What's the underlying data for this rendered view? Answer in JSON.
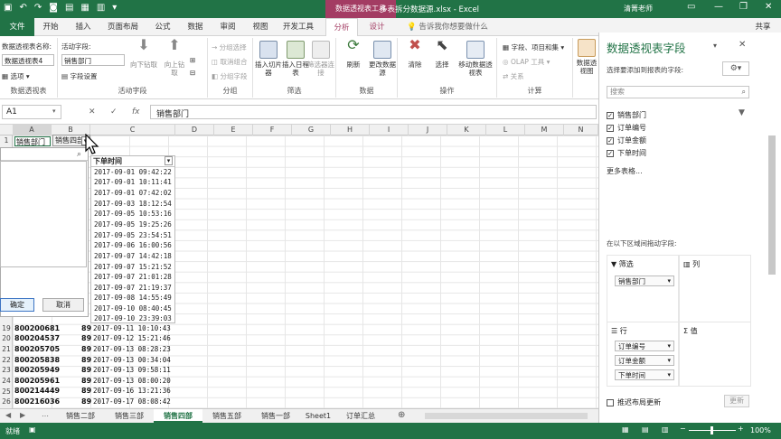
{
  "window": {
    "title": "多表拆分数据源.xlsx - Excel",
    "context_tab_title": "数据透视表工具",
    "user": "清箐老师"
  },
  "tabs": [
    {
      "label": "文件"
    },
    {
      "label": "开始"
    },
    {
      "label": "插入"
    },
    {
      "label": "页面布局"
    },
    {
      "label": "公式"
    },
    {
      "label": "数据"
    },
    {
      "label": "审阅"
    },
    {
      "label": "视图"
    },
    {
      "label": "开发工具"
    },
    {
      "label": "分析"
    },
    {
      "label": "设计"
    },
    {
      "label": "告诉我你想要做什么"
    },
    {
      "label": "共享"
    }
  ],
  "ribbon": {
    "pivot_name_label": "数据透视表名称:",
    "pivot_name_value": "数据透视表4",
    "options_label": "选项",
    "group_pivot": "数据透视表",
    "active_field_label": "活动字段:",
    "active_field_value": "销售部门",
    "field_settings": "字段设置",
    "drill_down": "向下钻取",
    "drill_up": "向上钻",
    "drill_up2": "取",
    "group_active_field": "活动字段",
    "group_selection": "分组选择",
    "ungroup": "取消组合",
    "group_field": "分组字段",
    "group_group": "分组",
    "insert_slicer": "插入切片器",
    "insert_timeline": "插入日程表",
    "filter_connections": "筛选器连接",
    "group_filter": "筛选",
    "refresh": "刷新",
    "change_source": "更改数据源",
    "group_data": "数据",
    "clear": "清除",
    "select": "选择",
    "move_pivot": "移动数据透视表",
    "group_actions": "操作",
    "fields_items": "字段、项目和集",
    "olap_tools": "OLAP 工具",
    "relationships": "关系",
    "group_calc": "计算",
    "pivot_chart": "数据透视图"
  },
  "formula": {
    "namebox": "A1",
    "fx": "fx",
    "content": "销售部门"
  },
  "columns": [
    "A",
    "B",
    "C",
    "D",
    "E",
    "F",
    "G",
    "H",
    "I",
    "J",
    "K",
    "L",
    "M",
    "N"
  ],
  "row1": {
    "a1": "销售部门",
    "b1": "销售四部"
  },
  "filter": {
    "ok": "确定",
    "cancel": "取消",
    "header": "下单时间"
  },
  "dropdown_items": [
    "2017-09-01 09:42:22",
    "2017-09-01 10:11:41",
    "2017-09-01 07:42:02",
    "2017-09-03 18:12:54",
    "2017-09-05 10:53:16",
    "2017-09-05 19:25:26",
    "2017-09-05 23:54:51",
    "2017-09-06 16:00:56",
    "2017-09-07 14:42:18",
    "2017-09-07 15:21:52",
    "2017-09-07 21:01:28",
    "2017-09-07 21:19:37",
    "2017-09-08 14:55:49",
    "2017-09-10 08:40:45",
    "2017-09-10 23:39:03"
  ],
  "rows": [
    {
      "n": "19",
      "a": "800200681",
      "b": "89",
      "c": "2017-09-11 10:10:43"
    },
    {
      "n": "20",
      "a": "800204537",
      "b": "89",
      "c": "2017-09-12 15:21:46"
    },
    {
      "n": "21",
      "a": "800205705",
      "b": "89",
      "c": "2017-09-13 08:28:23"
    },
    {
      "n": "22",
      "a": "800205838",
      "b": "89",
      "c": "2017-09-13 00:34:04"
    },
    {
      "n": "23",
      "a": "800205949",
      "b": "89",
      "c": "2017-09-13 09:58:11"
    },
    {
      "n": "24",
      "a": "800205961",
      "b": "89",
      "c": "2017-09-13 08:00:20"
    },
    {
      "n": "25",
      "a": "800214449",
      "b": "89",
      "c": "2017-09-16 13:21:36"
    },
    {
      "n": "26",
      "a": "800216036",
      "b": "89",
      "c": "2017-09-17 08:08:42"
    }
  ],
  "row_numbers_top": [
    "1"
  ],
  "sheet_tabs": [
    "销售二部",
    "销售三部",
    "销售四部",
    "销售五部",
    "销售一部",
    "Sheet1",
    "订单汇总"
  ],
  "active_sheet": "销售四部",
  "status": {
    "mode": "就绪",
    "zoom": "100%"
  },
  "panel": {
    "title": "数据透视表字段",
    "subtitle": "选择要添加到报表的字段:",
    "search_placeholder": "搜索",
    "fields": [
      "销售部门",
      "订单编号",
      "订单金额",
      "下单时间"
    ],
    "more_tables": "更多表格...",
    "drag_hint": "在以下区域间拖动字段:",
    "area_filter": "筛选",
    "area_columns": "列",
    "area_rows": "行",
    "area_values": "值",
    "filter_items": [
      "销售部门"
    ],
    "row_items": [
      "订单编号",
      "订单金额",
      "下单时间"
    ],
    "defer": "推迟布局更新",
    "update": "更新"
  }
}
